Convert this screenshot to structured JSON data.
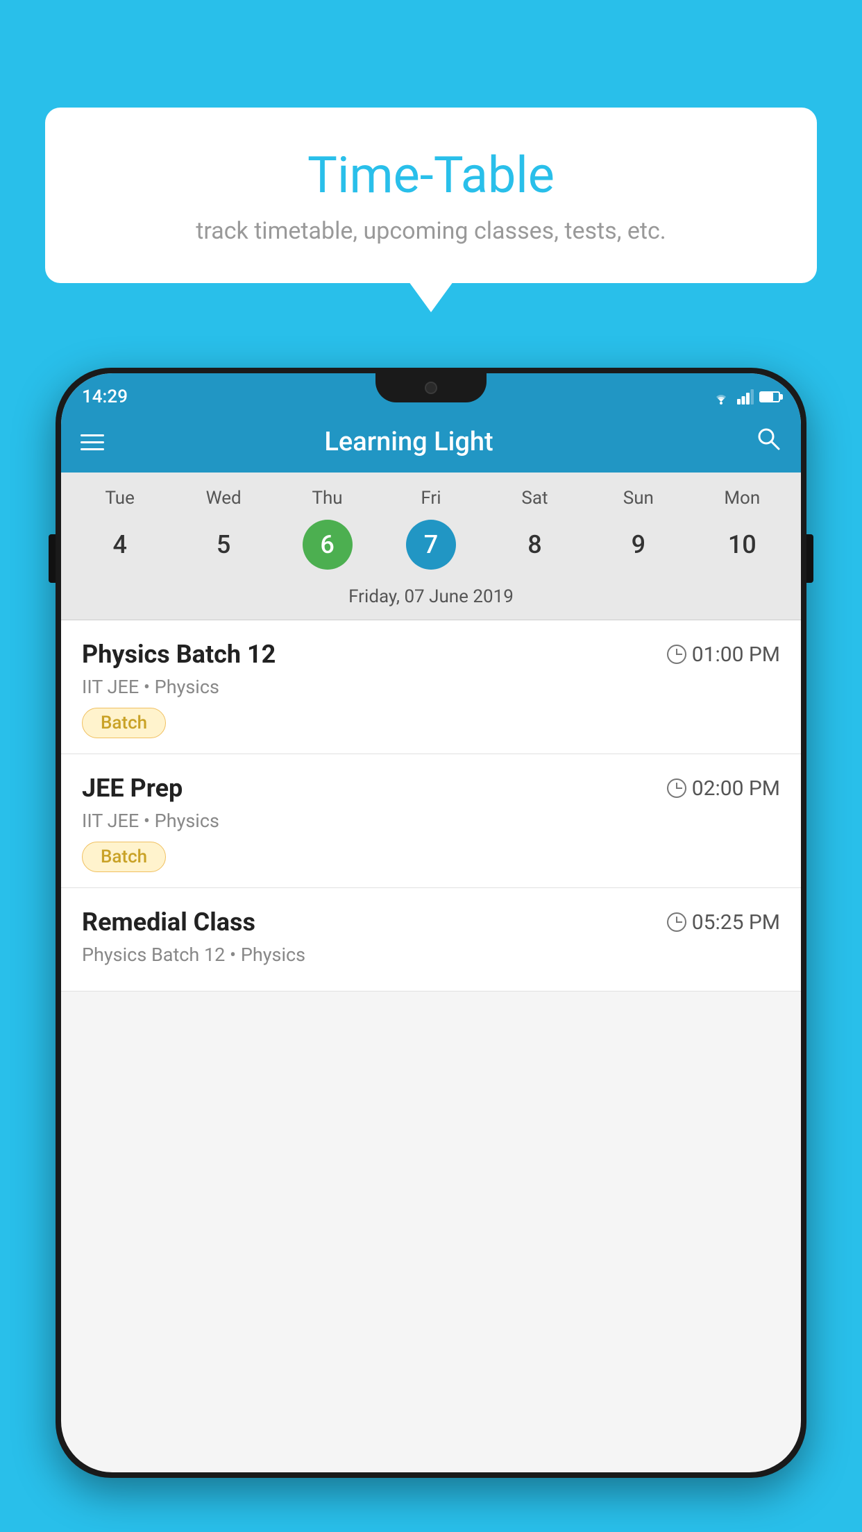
{
  "background_color": "#29BFEA",
  "bubble": {
    "title": "Time-Table",
    "subtitle": "track timetable, upcoming classes, tests, etc."
  },
  "phone": {
    "status_bar": {
      "time": "14:29"
    },
    "app_bar": {
      "title": "Learning Light"
    },
    "calendar": {
      "days": [
        "Tue",
        "Wed",
        "Thu",
        "Fri",
        "Sat",
        "Sun",
        "Mon"
      ],
      "dates": [
        "4",
        "5",
        "6",
        "7",
        "8",
        "9",
        "10"
      ],
      "today_index": 2,
      "selected_index": 3,
      "selected_date_label": "Friday, 07 June 2019"
    },
    "schedule": [
      {
        "title": "Physics Batch 12",
        "time": "01:00 PM",
        "sub": "IIT JEE • Physics",
        "tag": "Batch"
      },
      {
        "title": "JEE Prep",
        "time": "02:00 PM",
        "sub": "IIT JEE • Physics",
        "tag": "Batch"
      },
      {
        "title": "Remedial Class",
        "time": "05:25 PM",
        "sub": "Physics Batch 12 • Physics",
        "tag": ""
      }
    ]
  }
}
